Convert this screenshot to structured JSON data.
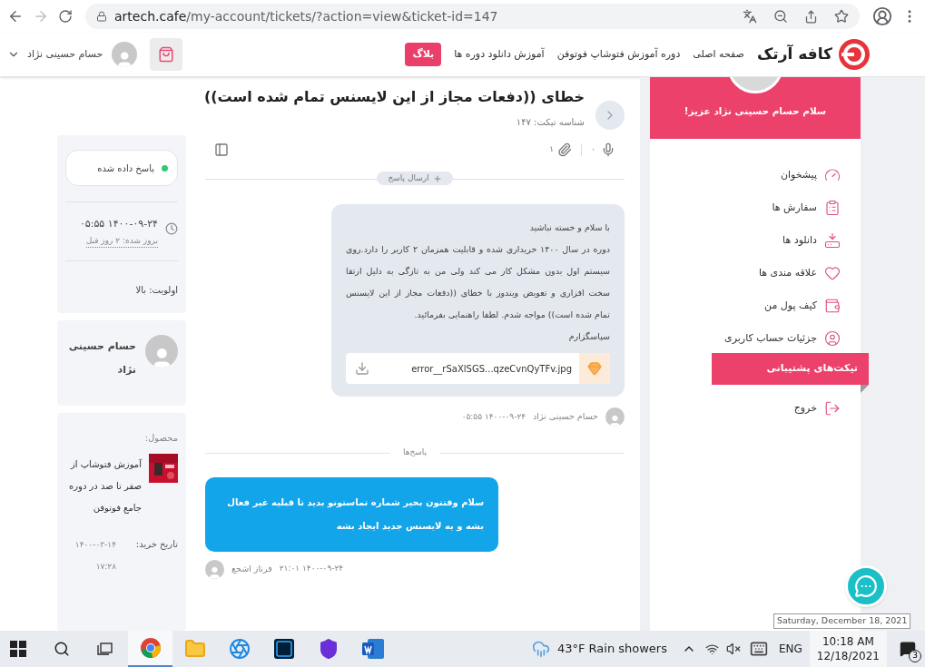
{
  "browser": {
    "url_host": "artech.cafe",
    "url_path": "/my-account/tickets/?action=view&ticket-id=147"
  },
  "header": {
    "logo": "کافه آرتک",
    "nav": [
      "صفحه اصلی",
      "دوره آموزش فتوشاپ فوتوفن",
      "آموزش دانلود دوره ها"
    ],
    "blog_button": "بلاگ",
    "user_name": "حسام حسینی نژاد"
  },
  "ticket": {
    "title": "خطای ((دفعات مجاز از این لایسنس تمام شده است))",
    "id_label": "شناسه تیکت: ۱۴۷"
  },
  "composer": {
    "voice_count": "۰",
    "attachment_count": "۱",
    "reply_button": "ارسال پاسخ"
  },
  "message": {
    "paragraphs": [
      "با سلام و خسته نباشید",
      "دوره در سال ۱۴۰۰ خریداری شده و قابلیت همزمان ۲ کاربر را دارد.روی سیستم اول بدون مشکل کار می کند ولی من به تازگی به دلیل ارتقا سخت افزاری و تعویض ویندوز با خطای ((دفعات مجاز از این لایسنس تمام شده است)) مواجه شدم. لطفا راهنمایی بفرمائید.",
      "سپاسگزارم"
    ],
    "attachment": "error__rSaXlSGS...qzeCvnQyTFv.jpg",
    "author": "حسام حسینی نژاد",
    "time": "۱۴۰۰-۰۹-۲۴ ۰۵:۵۵"
  },
  "replies_label": "پاسخ‌ها",
  "reply": {
    "text": "سلام وقتتون بخیر شماره تماستونو بدید تا قبلیه غیر فعال بشه و یه لایسنس جدید ایجاد بشه",
    "author": "فرناز اشجع",
    "time": "۱۴۰۰-۰۹-۲۴ ۲۱:۰۱"
  },
  "info": {
    "status": {
      "label": "پاسخ داده شده",
      "color": "#2ecc71"
    },
    "updated": "۱۴۰۰-۰۹-۲۴ ۰۵:۵۵",
    "updated_ago": "بروز شده: ۲ روز قبل",
    "priority": "اولویت: بالا",
    "user_name": "حسام حسینی نژاد",
    "product_label": "محصول:",
    "product_name": "آموزش فتوشاپ از صفر تا صد در دوره جامع فوتوفن",
    "purchase_label": "تاریخ خرید:",
    "purchase_date": "۱۴۰۰-۰۳-۱۴ ۱۷:۲۸"
  },
  "sidebar": {
    "greeting": "سلام حسام حسینی نژاد عزیز!",
    "items": [
      {
        "label": "پیشخوان",
        "selected": false
      },
      {
        "label": "سفارش ها",
        "selected": false
      },
      {
        "label": "دانلود ها",
        "selected": false
      },
      {
        "label": "علاقه مندی ها",
        "selected": false
      },
      {
        "label": "کیف پول من",
        "selected": false
      },
      {
        "label": "جزئیات حساب کاربری",
        "selected": false
      },
      {
        "label": "تیکت‌های پشتیبانی",
        "selected": true
      },
      {
        "label": "خروج",
        "selected": false
      }
    ]
  },
  "tooltip": "Saturday, December 18, 2021",
  "taskbar": {
    "apps": [
      {
        "selected": true
      },
      {
        "selected": false
      },
      {
        "selected": false
      },
      {
        "selected": false
      },
      {
        "selected": false
      },
      {
        "selected": false
      }
    ],
    "weather": "43°F Rain showers",
    "language": "ENG",
    "time": "10:18 AM",
    "date": "12/18/2021",
    "notifications": "3"
  }
}
